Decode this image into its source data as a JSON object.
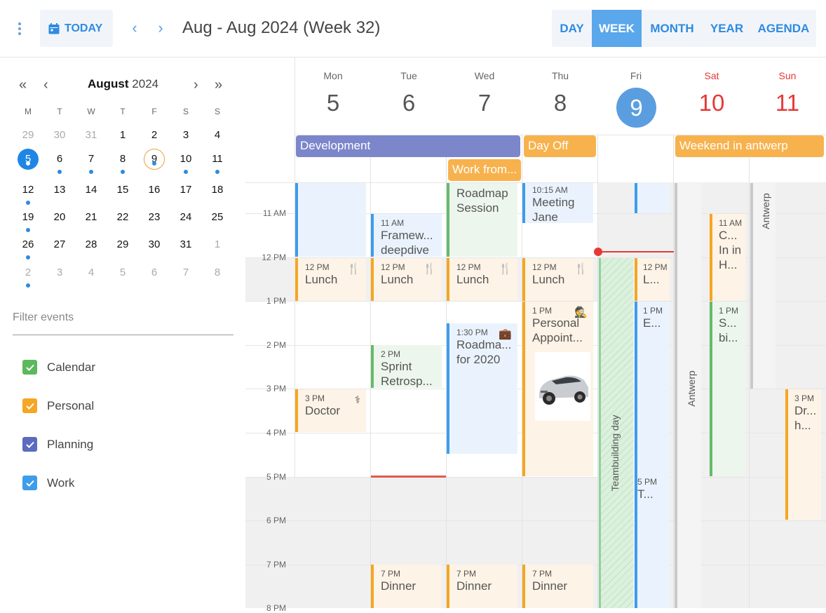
{
  "toolbar": {
    "today_label": "TODAY",
    "title": "Aug - Aug 2024 (Week 32)",
    "views": [
      "DAY",
      "WEEK",
      "MONTH",
      "YEAR",
      "AGENDA"
    ],
    "active_view": "WEEK"
  },
  "mini_calendar": {
    "month": "August",
    "year": "2024",
    "weekdays": [
      "M",
      "T",
      "W",
      "T",
      "F",
      "S",
      "S"
    ],
    "weeks": [
      [
        "29",
        "30",
        "31",
        "1",
        "2",
        "3",
        "4"
      ],
      [
        "5",
        "6",
        "7",
        "8",
        "9",
        "10",
        "11"
      ],
      [
        "12",
        "13",
        "14",
        "15",
        "16",
        "17",
        "18"
      ],
      [
        "19",
        "20",
        "21",
        "22",
        "23",
        "24",
        "25"
      ],
      [
        "26",
        "27",
        "28",
        "29",
        "30",
        "31",
        "1"
      ],
      [
        "2",
        "3",
        "4",
        "5",
        "6",
        "7",
        "8"
      ]
    ]
  },
  "filter": {
    "placeholder": "Filter events"
  },
  "calendars": [
    {
      "label": "Calendar",
      "color": "#5cb85c"
    },
    {
      "label": "Personal",
      "color": "#f5a623"
    },
    {
      "label": "Planning",
      "color": "#5c6bc0"
    },
    {
      "label": "Work",
      "color": "#3d9cec"
    }
  ],
  "days": [
    {
      "name": "Mon",
      "date": "5"
    },
    {
      "name": "Tue",
      "date": "6"
    },
    {
      "name": "Wed",
      "date": "7"
    },
    {
      "name": "Thu",
      "date": "8"
    },
    {
      "name": "Fri",
      "date": "9"
    },
    {
      "name": "Sat",
      "date": "10"
    },
    {
      "name": "Sun",
      "date": "11"
    }
  ],
  "all_day": [
    {
      "title": "Development",
      "color": "#7b86cb"
    },
    {
      "title": "Day Off",
      "color": "#f7b24e"
    },
    {
      "title": "Weekend in antwerp",
      "color": "#f7b24e"
    },
    {
      "title": "Work from...",
      "color": "#f7b24e"
    }
  ],
  "time_labels": [
    "11 AM",
    "12 PM",
    "1 PM",
    "2 PM",
    "3 PM",
    "4 PM",
    "5 PM",
    "6 PM",
    "7 PM",
    "8 PM"
  ],
  "events": {
    "mon_lunch": {
      "time": "12 PM",
      "title": "Lunch"
    },
    "mon_doctor": {
      "time": "3 PM",
      "title": "Doctor"
    },
    "tue_framework": {
      "time": "11 AM",
      "title": "Framew... deepdive"
    },
    "tue_lunch": {
      "time": "12 PM",
      "title": "Lunch"
    },
    "tue_sprint": {
      "time": "2 PM",
      "title": "Sprint Retrosp..."
    },
    "tue_dinner": {
      "time": "7 PM",
      "title": "Dinner"
    },
    "wed_roadmap_session": {
      "title": "Roadmap Session"
    },
    "wed_lunch": {
      "time": "12 PM",
      "title": "Lunch"
    },
    "wed_roadmap_2020": {
      "time": "1:30 PM",
      "title": "Roadma... for 2020"
    },
    "wed_dinner": {
      "time": "7 PM",
      "title": "Dinner"
    },
    "thu_meeting": {
      "time": "10:15 AM",
      "title": "Meeting Jane"
    },
    "thu_lunch": {
      "time": "12 PM",
      "title": "Lunch"
    },
    "thu_personal": {
      "time": "1 PM",
      "title": "Personal Appoint..."
    },
    "thu_dinner": {
      "time": "7 PM",
      "title": "Dinner"
    },
    "fri_teambuilding": {
      "title": "Teambuilding day"
    },
    "fri_l": {
      "time": "12 PM",
      "title": "L..."
    },
    "fri_e": {
      "time": "1 PM",
      "title": "E..."
    },
    "fri_t": {
      "time": "5 PM",
      "title": "T..."
    },
    "sat_antwerp": {
      "title": "Antwerp"
    },
    "sat_c": {
      "time": "11 AM",
      "title": "C... In in H..."
    },
    "sat_s": {
      "time": "1 PM",
      "title": "S... bi..."
    },
    "sun_antwerp": {
      "title": "Antwerp"
    },
    "sun_dr": {
      "time": "3 PM",
      "title": "Dr... h..."
    }
  }
}
